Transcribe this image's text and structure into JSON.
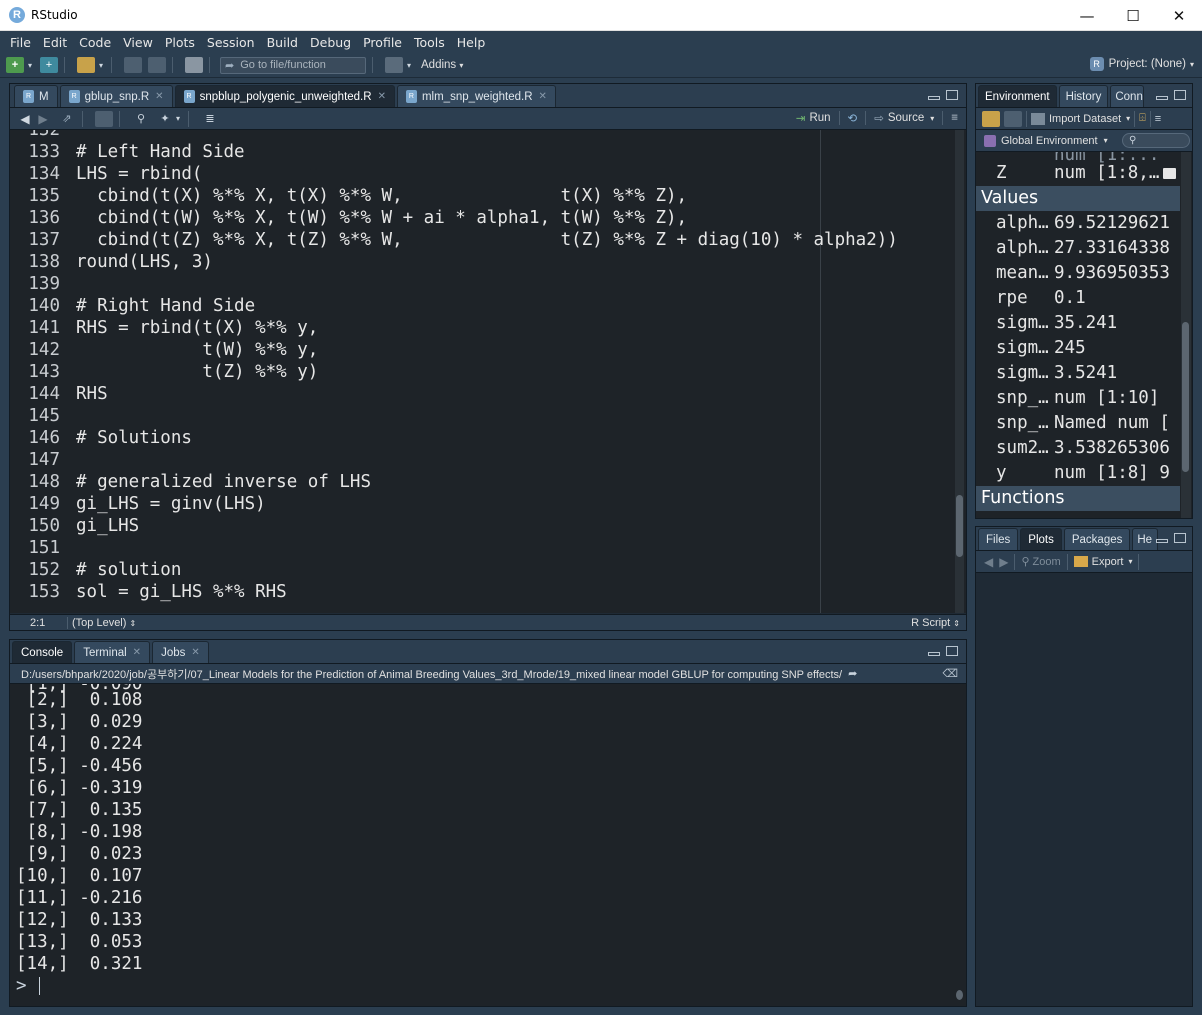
{
  "window": {
    "title": "RStudio",
    "minimize": "—",
    "maximize": "☐",
    "close": "✕"
  },
  "menu": [
    "File",
    "Edit",
    "Code",
    "View",
    "Plots",
    "Session",
    "Build",
    "Debug",
    "Profile",
    "Tools",
    "Help"
  ],
  "toolbar": {
    "goto_placeholder": "Go to file/function",
    "addins_label": "Addins",
    "project_label": "Project: (None)"
  },
  "editor": {
    "tabs": [
      {
        "label": "M",
        "active": false
      },
      {
        "label": "gblup_snp.R",
        "active": false
      },
      {
        "label": "snpblup_polygenic_unweighted.R",
        "active": true
      },
      {
        "label": "mlm_snp_weighted.R",
        "active": false
      }
    ],
    "run_label": "Run",
    "source_label": "Source",
    "lines": [
      {
        "n": "132",
        "t": ""
      },
      {
        "n": "133",
        "t": "# Left Hand Side"
      },
      {
        "n": "134",
        "t": "LHS = rbind("
      },
      {
        "n": "135",
        "t": "  cbind(t(X) %*% X, t(X) %*% W,               t(X) %*% Z),"
      },
      {
        "n": "136",
        "t": "  cbind(t(W) %*% X, t(W) %*% W + ai * alpha1, t(W) %*% Z),"
      },
      {
        "n": "137",
        "t": "  cbind(t(Z) %*% X, t(Z) %*% W,               t(Z) %*% Z + diag(10) * alpha2))"
      },
      {
        "n": "138",
        "t": "round(LHS, 3)"
      },
      {
        "n": "139",
        "t": ""
      },
      {
        "n": "140",
        "t": "# Right Hand Side"
      },
      {
        "n": "141",
        "t": "RHS = rbind(t(X) %*% y,"
      },
      {
        "n": "142",
        "t": "            t(W) %*% y,"
      },
      {
        "n": "143",
        "t": "            t(Z) %*% y)"
      },
      {
        "n": "144",
        "t": "RHS"
      },
      {
        "n": "145",
        "t": ""
      },
      {
        "n": "146",
        "t": "# Solutions"
      },
      {
        "n": "147",
        "t": ""
      },
      {
        "n": "148",
        "t": "# generalized inverse of LHS"
      },
      {
        "n": "149",
        "t": "gi_LHS = ginv(LHS)"
      },
      {
        "n": "150",
        "t": "gi_LHS"
      },
      {
        "n": "151",
        "t": ""
      },
      {
        "n": "152",
        "t": "# solution"
      },
      {
        "n": "153",
        "t": "sol = gi_LHS %*% RHS"
      }
    ],
    "status": {
      "position": "2:1",
      "scope": "(Top Level)",
      "filetype": "R Script"
    }
  },
  "console": {
    "tabs": [
      {
        "label": "Console",
        "active": true
      },
      {
        "label": "Terminal",
        "active": false
      },
      {
        "label": "Jobs",
        "active": false
      }
    ],
    "path": "D:/users/bhpark/2020/job/공부하기/07_Linear Models for the Prediction of Animal Breeding Values_3rd_Mrode/19_mixed linear model GBLUP for computing SNP effects/",
    "output": [
      " [2,]  0.108",
      " [3,]  0.029",
      " [4,]  0.224",
      " [5,] -0.456",
      " [6,] -0.319",
      " [7,]  0.135",
      " [8,] -0.198",
      " [9,]  0.023",
      "[10,]  0.107",
      "[11,] -0.216",
      "[12,]  0.133",
      "[13,]  0.053",
      "[14,]  0.321"
    ],
    "prompt": ">"
  },
  "environment": {
    "tabs": [
      {
        "label": "Environment",
        "active": true
      },
      {
        "label": "History",
        "active": false
      },
      {
        "label": "Conn",
        "active": false
      }
    ],
    "import_label": "Import Dataset",
    "scope_label": "Global Environment",
    "top_row": {
      "name": "Z",
      "value": "num [1:8,…"
    },
    "values_header": "Values",
    "values": [
      {
        "name": "alph…",
        "value": "69.52129621…"
      },
      {
        "name": "alph…",
        "value": "27.33164338…"
      },
      {
        "name": "mean…",
        "value": "9.936950353…"
      },
      {
        "name": "rpe",
        "value": "0.1"
      },
      {
        "name": "sigm…",
        "value": "35.241"
      },
      {
        "name": "sigm…",
        "value": "245"
      },
      {
        "name": "sigm…",
        "value": "3.5241"
      },
      {
        "name": "snp_…",
        "value": "num [1:10] …"
      },
      {
        "name": "snp_…",
        "value": "Named num […"
      },
      {
        "name": "sum2…",
        "value": "3.538265306…"
      },
      {
        "name": "y",
        "value": "num [1:8] 9…"
      }
    ],
    "functions_header": "Functions"
  },
  "files": {
    "tabs": [
      {
        "label": "Files",
        "active": false
      },
      {
        "label": "Plots",
        "active": true
      },
      {
        "label": "Packages",
        "active": false
      },
      {
        "label": "He",
        "active": false
      }
    ],
    "zoom_label": "Zoom",
    "export_label": "Export"
  }
}
